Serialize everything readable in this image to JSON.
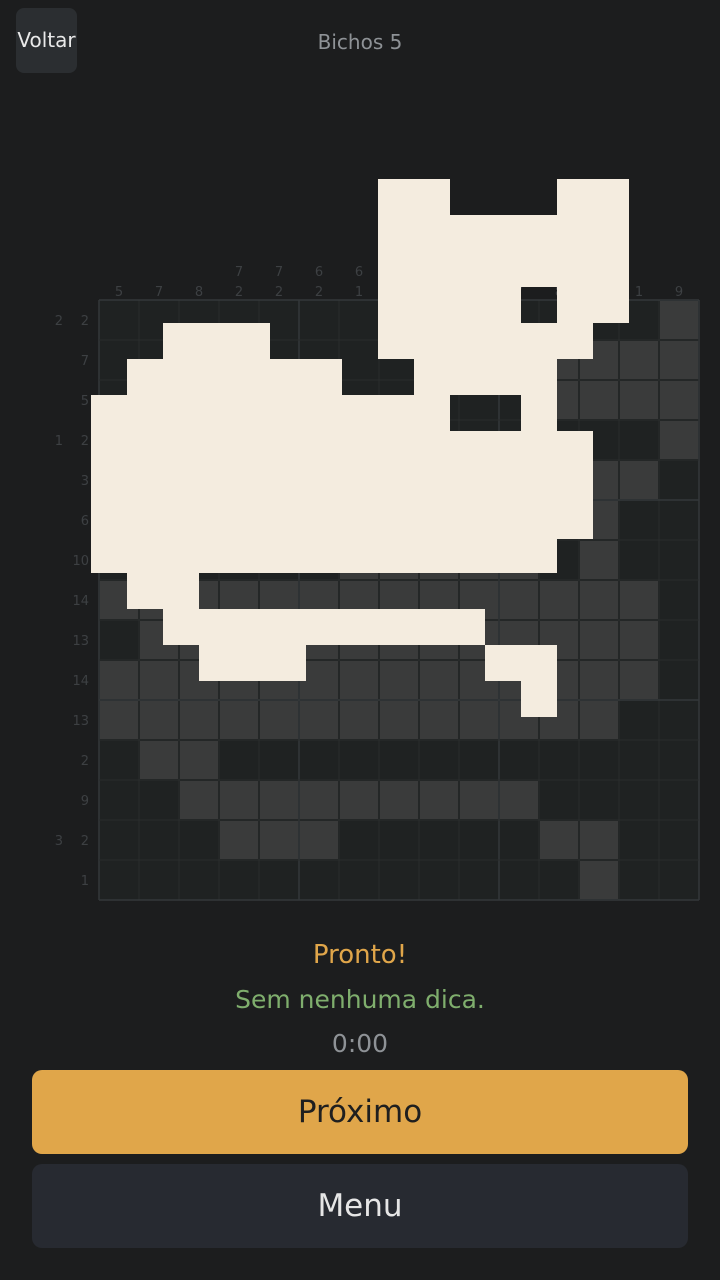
{
  "header": {
    "back_label": "Voltar",
    "level_title": "Bichos 5"
  },
  "puzzle": {
    "columns": 15,
    "rows": 15,
    "column_clues": [
      [
        "5"
      ],
      [
        "7"
      ],
      [
        "8"
      ],
      [
        "7",
        "2"
      ],
      [
        "7",
        "2"
      ],
      [
        "6",
        "2"
      ],
      [
        "6",
        "1"
      ],
      [
        "7"
      ],
      [
        "7"
      ],
      [
        "7"
      ],
      [
        "7"
      ],
      [
        "8"
      ],
      [
        "9"
      ],
      [
        "1"
      ],
      [
        "9"
      ]
    ],
    "row_clues": [
      [
        "2",
        "2"
      ],
      [
        "7"
      ],
      [
        "5"
      ],
      [
        "1",
        "2"
      ],
      [
        "3"
      ],
      [
        "6"
      ],
      [
        "10"
      ],
      [
        "14"
      ],
      [
        "13"
      ],
      [
        "14"
      ],
      [
        "13"
      ],
      [
        "2"
      ],
      [
        "9"
      ],
      [
        "3",
        "2"
      ],
      [
        "1"
      ]
    ],
    "solution_rows": [
      "..............#",
      "...........####",
      "...........####",
      "..............#",
      "............##.",
      "...........##..",
      "......#####.#..",
      "##############.",
      ".#############.",
      "##############.",
      "#############..",
      ".##............",
      "..#########....",
      "...###.....##..",
      "............#.."
    ],
    "colors": {
      "board_bg": "#1f2222",
      "filled_cell": "#3a3b3b",
      "grid_line": "#2a2c2c",
      "overlay": "#f4ecdf",
      "shadow": "#1a1c1e"
    }
  },
  "result": {
    "status": "Pronto!",
    "hint_text": "Sem nenhuma dica.",
    "timer": "0:00"
  },
  "buttons": {
    "next_label": "Próximo",
    "menu_label": "Menu"
  }
}
